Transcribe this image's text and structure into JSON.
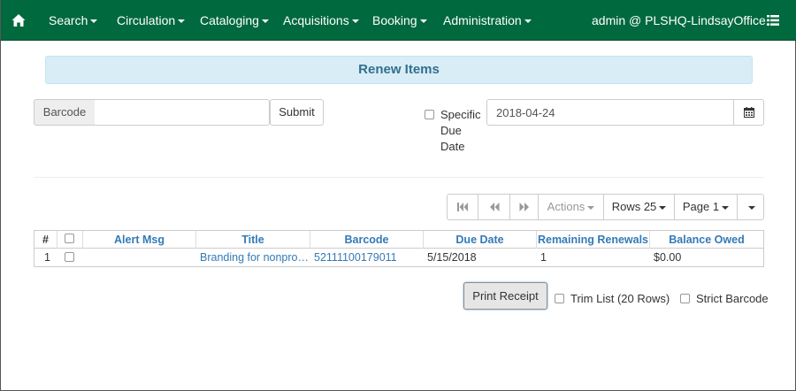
{
  "navbar": {
    "home_icon": "home-icon",
    "menus": [
      {
        "label": "Search"
      },
      {
        "label": "Circulation"
      },
      {
        "label": "Cataloging"
      },
      {
        "label": "Acquisitions"
      },
      {
        "label": "Booking"
      },
      {
        "label": "Administration"
      }
    ],
    "user": "admin @ PLSHQ-LindsayOffice",
    "menu_icon": "list-icon",
    "bg_color": "#00693e"
  },
  "page": {
    "title": "Renew Items"
  },
  "barcode": {
    "addon_label": "Barcode",
    "value": "",
    "placeholder": "",
    "submit_label": "Submit"
  },
  "due_date": {
    "checkbox_checked": false,
    "label_lines": [
      "Specific",
      "Due",
      "Date"
    ],
    "value": "2018-04-24",
    "calendar_icon": "calendar-icon"
  },
  "toolbar": {
    "first_icon": "first-page-icon",
    "prev_icon": "previous-page-icon",
    "next_icon": "next-page-icon",
    "actions_label": "Actions",
    "rows_label": "Rows 25",
    "page_label": "Page 1"
  },
  "grid": {
    "columns": [
      "#",
      "",
      "Alert Msg",
      "Title",
      "Barcode",
      "Due Date",
      "Remaining Renewals",
      "Balance Owed"
    ],
    "rows": [
      {
        "index": "1",
        "selected": false,
        "alert_msg": "",
        "title": "Branding for nonprofits",
        "barcode": "52111100179011",
        "due_date": "5/15/2018",
        "remaining_renewals": "1",
        "balance_owed": "$0.00"
      }
    ]
  },
  "footer": {
    "print_label": "Print Receipt",
    "trim_list_label": "Trim List (20 Rows)",
    "trim_list_checked": false,
    "strict_barcode_label": "Strict Barcode",
    "strict_barcode_checked": false
  }
}
